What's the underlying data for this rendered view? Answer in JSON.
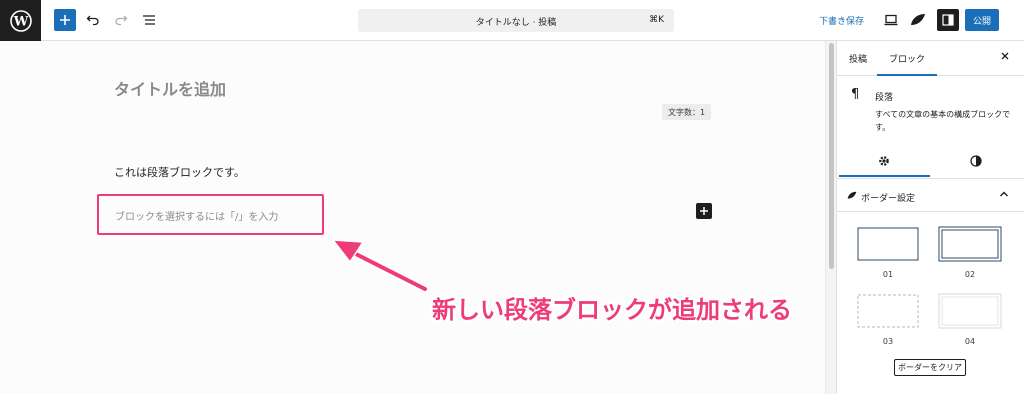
{
  "topbar": {
    "document_title": "タイトルなし · 投稿",
    "shortcut": "⌘K",
    "save_draft": "下書き保存",
    "publish": "公開"
  },
  "editor": {
    "title_placeholder": "タイトルを追加",
    "char_count": "文字数：1",
    "paragraph": "これは段落ブロックです。",
    "new_block_placeholder": "ブロックを選択するには「/」を入力",
    "callout": "新しい段落ブロックが追加される"
  },
  "sidebar": {
    "tabs": [
      "投稿",
      "ブロック"
    ],
    "block_name": "段落",
    "block_description": "すべての文章の基本の構成ブロックです。",
    "panel_title": "ボーダー設定",
    "border_options": [
      "01",
      "02",
      "03",
      "04"
    ],
    "clear_button": "ボーダーをクリア"
  },
  "colors": {
    "accent": "#1a6fb8",
    "highlight": "#ee3c78",
    "dark": "#1e1e1e"
  },
  "icons": [
    "wordpress-logo",
    "plus-icon",
    "undo-icon",
    "redo-icon",
    "list-view-icon",
    "desktop-preview-icon",
    "style-icon",
    "sidebar-toggle-icon",
    "close-icon",
    "pilcrow-icon",
    "gear-icon",
    "contrast-icon",
    "chevron-up-icon"
  ]
}
